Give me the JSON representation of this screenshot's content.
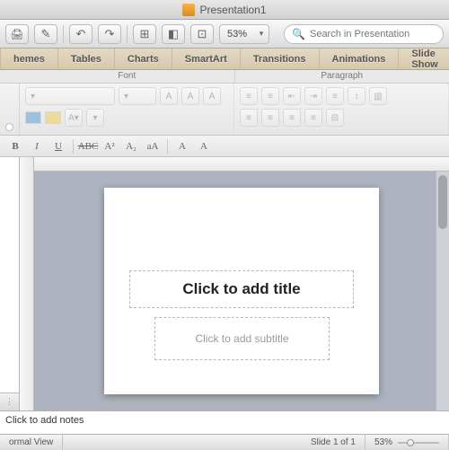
{
  "window": {
    "title": "Presentation1"
  },
  "toolbar": {
    "zoom_value": "53%",
    "search_placeholder": "Search in Presentation"
  },
  "tabs": [
    "hemes",
    "Tables",
    "Charts",
    "SmartArt",
    "Transitions",
    "Animations",
    "Slide Show"
  ],
  "ribbon_groups": {
    "font": "Font",
    "paragraph": "Paragraph"
  },
  "format": {
    "bold": "B",
    "italic": "I",
    "underline": "U",
    "strike": "ABC",
    "sup": "A²",
    "sub": "A₂",
    "case": "aA",
    "big": "A",
    "small": "A"
  },
  "slide": {
    "title_placeholder": "Click to add title",
    "subtitle_placeholder": "Click to add subtitle"
  },
  "notes": {
    "placeholder": "Click to add notes"
  },
  "status": {
    "view": "ormal View",
    "slide_info": "Slide 1 of 1",
    "zoom": "53%"
  }
}
